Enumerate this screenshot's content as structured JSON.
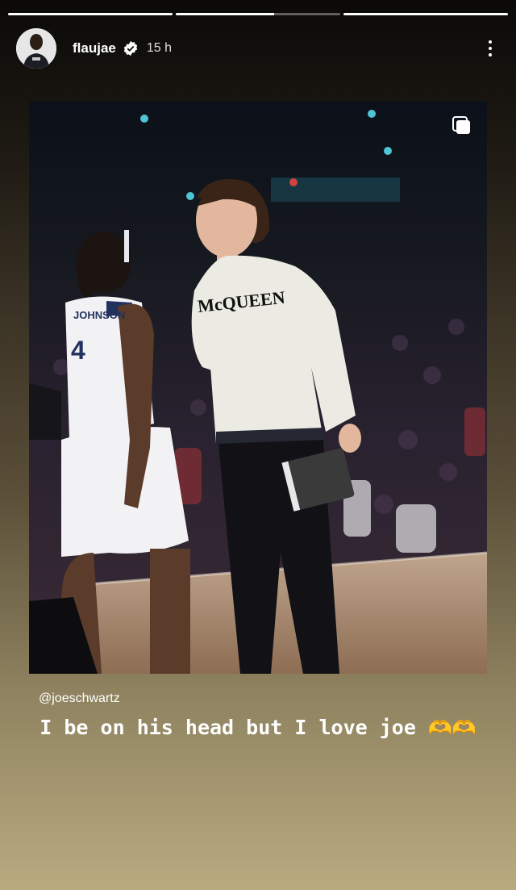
{
  "story": {
    "progress": [
      1,
      0.6,
      1
    ]
  },
  "header": {
    "username": "flaujae",
    "time": "15 h"
  },
  "post": {
    "jersey_name": "JOHNSON",
    "jersey_number": "4",
    "sweater_text": "McQUEEN"
  },
  "mention": "@joeschwartz",
  "caption": {
    "text": "I be on his head but I love joe",
    "emoji": "🫶🫶"
  }
}
